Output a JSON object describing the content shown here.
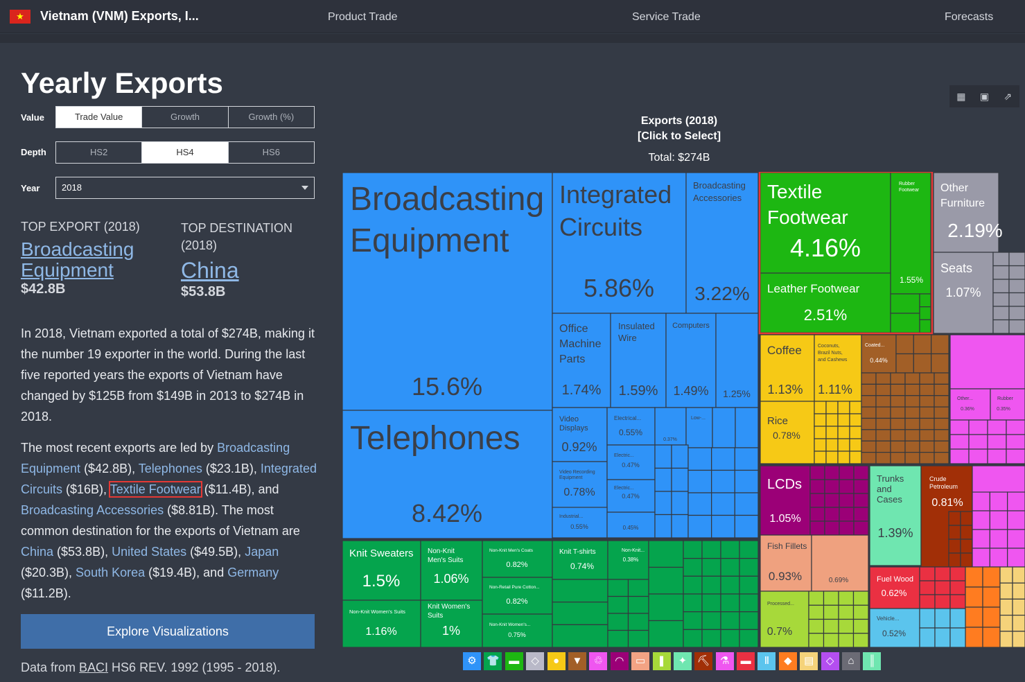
{
  "header": {
    "title": "Vietnam (VNM) Exports, I...",
    "nav": [
      "Product Trade",
      "Service Trade",
      "Forecasts"
    ]
  },
  "main": {
    "title": "Yearly Exports",
    "controls": {
      "value_label": "Value",
      "value_options": [
        "Trade Value",
        "Growth",
        "Growth (%)"
      ],
      "value_selected": "Trade Value",
      "depth_label": "Depth",
      "depth_options": [
        "HS2",
        "HS4",
        "HS6"
      ],
      "depth_selected": "HS4",
      "year_label": "Year",
      "year_value": "2018"
    },
    "top_export": {
      "label": "TOP EXPORT (2018)",
      "line1": "Broadcasting",
      "line2": "Equipment",
      "value": "$42.8B"
    },
    "top_destination": {
      "label_line1": "TOP DESTINATION",
      "label_line2": "(2018)",
      "name": "China",
      "value": "$53.8B"
    },
    "summary": "In 2018, Vietnam exported a total of $274B, making it the number 19 exporter in the world. During the last five reported years the exports of Vietnam have changed by $125B from $149B in 2013 to $274B in 2018.",
    "details": {
      "t0": "The most recent exports are led by ",
      "l1": "Broadcasting Equipment",
      "t1": " ($42.8B), ",
      "l2": "Telephones",
      "t2": " ($23.1B), ",
      "l3": "Integrated Circuits",
      "t3": " ($16B), ",
      "l4": "Textile Footwear",
      "t4": " ($11.4B), and ",
      "l5": "Broadcasting Accessories",
      "t5": " ($8.81B). The most common destination for the exports of Vietnam are ",
      "l6": "China",
      "t6": " ($53.8B), ",
      "l7": "United States",
      "t7": " ($49.5B), ",
      "l8": "Japan",
      "t8": " ($20.3B), ",
      "l9": "South Korea",
      "t9": " ($19.4B), and ",
      "l10": "Germany",
      "t10": " ($11.2B)."
    },
    "explore_button": "Explore Visualizations",
    "footer": {
      "pre": "Data from ",
      "link": "BACI",
      "post": " HS6 REV. 1992 (1995 - 2018)."
    }
  },
  "chart": {
    "title_line1": "Exports (2018)",
    "title_line2": "[Click to Select]",
    "total": "Total: $274B",
    "toolbar_icons": [
      "table-icon",
      "image-icon",
      "share-icon"
    ],
    "colors": {
      "machines": "#2f93f8",
      "textiles": "#05a44d",
      "footwear": "#1db712",
      "furniture": "#9a9aa8",
      "vegetables": "#f6c916",
      "foodstuffs": "#a25f27",
      "misc": "#ef56f0",
      "instruments": "#9b0077",
      "animal_hides": "#6fe6b0",
      "mineral": "#a12f07",
      "stone": "#ea3042",
      "chemicals": "#ff7c20",
      "animal_products": "#efa17f",
      "animal_veg": "#a7d93a",
      "transport": "#5bc4ed",
      "selected_border": "#e53935"
    }
  },
  "chart_data": {
    "type": "treemap",
    "unit": "% of total exports",
    "items": [
      {
        "label": "Broadcasting Equipment",
        "value": "15.6%",
        "group": "machines"
      },
      {
        "label": "Telephones",
        "value": "8.42%",
        "group": "machines"
      },
      {
        "label": "Integrated Circuits",
        "value": "5.86%",
        "group": "machines"
      },
      {
        "label": "Broadcasting Accessories",
        "value": "3.22%",
        "group": "machines"
      },
      {
        "label": "Office Machine Parts",
        "value": "1.74%",
        "group": "machines"
      },
      {
        "label": "Insulated Wire",
        "value": "1.59%",
        "group": "machines"
      },
      {
        "label": "Computers",
        "value": "1.49%",
        "group": "machines"
      },
      {
        "label": "",
        "value": "1.25%",
        "group": "machines"
      },
      {
        "label": "Video Displays",
        "value": "0.92%",
        "group": "machines"
      },
      {
        "label": "Electrical...",
        "value": "0.55%",
        "group": "machines"
      },
      {
        "label": "",
        "value": "0.37%",
        "group": "machines"
      },
      {
        "label": "Low-...",
        "value": "",
        "group": "machines"
      },
      {
        "label": "Electric...",
        "value": "0.47%",
        "group": "machines"
      },
      {
        "label": "Video Recording Equipment",
        "value": "0.78%",
        "group": "machines"
      },
      {
        "label": "Electric...",
        "value": "0.47%",
        "group": "machines"
      },
      {
        "label": "Industrial...",
        "value": "0.55%",
        "group": "machines"
      },
      {
        "label": "",
        "value": "0.45%",
        "group": "machines"
      },
      {
        "label": "Textile Footwear",
        "value": "4.16%",
        "group": "footwear"
      },
      {
        "label": "Rubber Footwear",
        "value": "1.55%",
        "group": "footwear"
      },
      {
        "label": "Leather Footwear",
        "value": "2.51%",
        "group": "footwear"
      },
      {
        "label": "Other Furniture",
        "value": "2.19%",
        "group": "furniture"
      },
      {
        "label": "Seats",
        "value": "1.07%",
        "group": "furniture"
      },
      {
        "label": "Coffee",
        "value": "1.13%",
        "group": "vegetables"
      },
      {
        "label": "Coconuts, Brazil Nuts, and Cashews",
        "value": "1.11%",
        "group": "vegetables"
      },
      {
        "label": "Rice",
        "value": "0.78%",
        "group": "vegetables"
      },
      {
        "label": "Coated...",
        "value": "0.44%",
        "group": "foodstuffs"
      },
      {
        "label": "Other...",
        "value": "0.36%",
        "group": "misc"
      },
      {
        "label": "Rubber",
        "value": "0.35%",
        "group": "misc"
      },
      {
        "label": "LCDs",
        "value": "1.05%",
        "group": "instruments"
      },
      {
        "label": "Trunks and Cases",
        "value": "1.39%",
        "group": "animal_hides"
      },
      {
        "label": "Crude Petroleum",
        "value": "0.81%",
        "group": "mineral"
      },
      {
        "label": "Fish Fillets",
        "value": "0.93%",
        "group": "animal_products"
      },
      {
        "label": "",
        "value": "0.69%",
        "group": "animal_products"
      },
      {
        "label": "Fuel Wood",
        "value": "0.62%",
        "group": "stone"
      },
      {
        "label": "Processed...",
        "value": "0.7%",
        "group": "animal_veg"
      },
      {
        "label": "Vehicle...",
        "value": "0.52%",
        "group": "transport"
      },
      {
        "label": "Knit Sweaters",
        "value": "1.5%",
        "group": "textiles"
      },
      {
        "label": "Non-Knit Men's Suits",
        "value": "1.06%",
        "group": "textiles"
      },
      {
        "label": "Non-Knit Men's Coats",
        "value": "0.82%",
        "group": "textiles"
      },
      {
        "label": "Non-Retail Pure Cotton...",
        "value": "0.82%",
        "group": "textiles"
      },
      {
        "label": "Knit T-shirts",
        "value": "0.74%",
        "group": "textiles"
      },
      {
        "label": "Non-Knit...",
        "value": "0.38%",
        "group": "textiles"
      },
      {
        "label": "Non-Knit Women's Suits",
        "value": "1.16%",
        "group": "textiles"
      },
      {
        "label": "Knit Women's Suits",
        "value": "1%",
        "group": "textiles"
      },
      {
        "label": "Non-Knit Women's...",
        "value": "0.75%",
        "group": "textiles"
      }
    ]
  },
  "legend_icons": [
    {
      "name": "machines-icon",
      "glyph": "⚙",
      "color": "#2f93f8"
    },
    {
      "name": "textiles-icon",
      "glyph": "👕",
      "color": "#05a44d"
    },
    {
      "name": "footwear-icon",
      "glyph": "▬",
      "color": "#1db712"
    },
    {
      "name": "metals-icon",
      "glyph": "◇",
      "color": "#b9b9c8"
    },
    {
      "name": "vegetables-icon",
      "glyph": "●",
      "color": "#f6c916"
    },
    {
      "name": "foodstuffs-icon",
      "glyph": "▼",
      "color": "#a25f27"
    },
    {
      "name": "misc-icon",
      "glyph": "♲",
      "color": "#ef56f0"
    },
    {
      "name": "instruments-icon",
      "glyph": "◠",
      "color": "#9b0077"
    },
    {
      "name": "furniture-icon",
      "glyph": "▭",
      "color": "#f3a384"
    },
    {
      "name": "plastics-icon",
      "glyph": "❚",
      "color": "#a7d93a"
    },
    {
      "name": "hides-icon",
      "glyph": "✦",
      "color": "#6fe6b0"
    },
    {
      "name": "mineral-icon",
      "glyph": "⛏",
      "color": "#a12f07"
    },
    {
      "name": "chemicals-icon",
      "glyph": "⚗",
      "color": "#ef56f0"
    },
    {
      "name": "weapons-icon",
      "glyph": "▬",
      "color": "#ea3042"
    },
    {
      "name": "paper-icon",
      "glyph": "Ⅱ",
      "color": "#5bc4ed"
    },
    {
      "name": "animal-products-icon",
      "glyph": "◆",
      "color": "#ff7c20"
    },
    {
      "name": "paper-goods-icon",
      "glyph": "▤",
      "color": "#f5d37a"
    },
    {
      "name": "precious-icon",
      "glyph": "◇",
      "color": "#b44ef0"
    },
    {
      "name": "arts-icon",
      "glyph": "⌂",
      "color": "#6b6b75"
    },
    {
      "name": "textiles-raw-icon",
      "glyph": "║",
      "color": "#6fe6b0"
    }
  ]
}
